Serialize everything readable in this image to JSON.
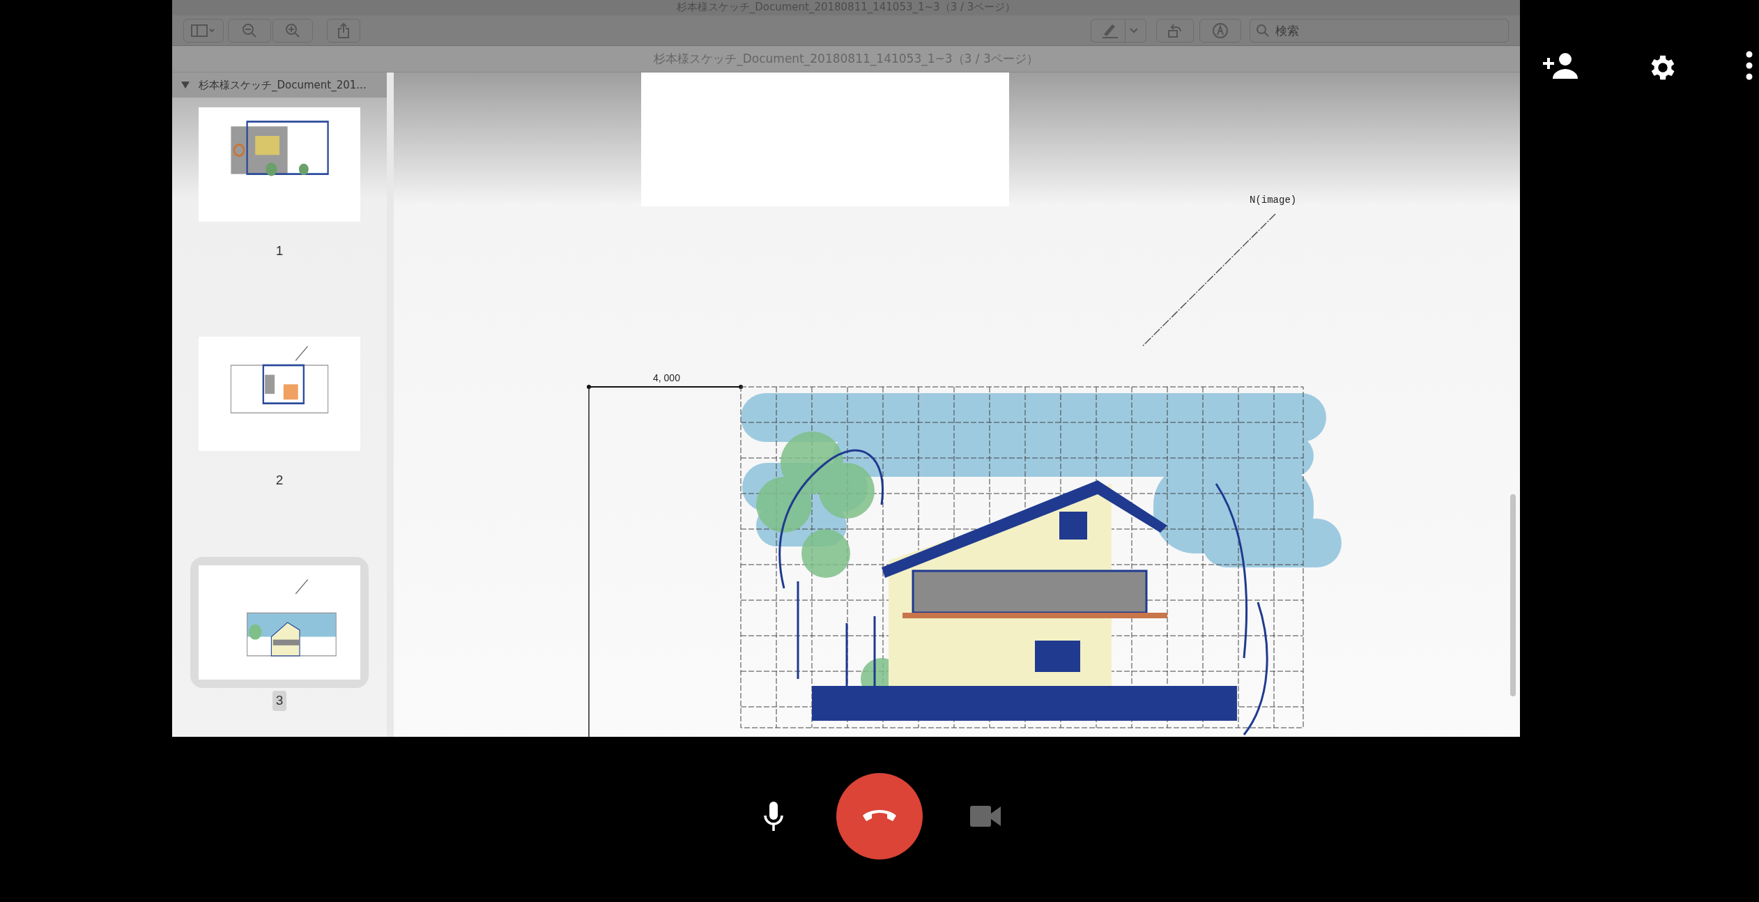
{
  "window": {
    "title": "杉本様スケッチ_Document_20180811_141053_1~3（3 / 3ページ）"
  },
  "toolbar": {
    "search": {
      "placeholder": "検索"
    }
  },
  "path_bar": {
    "text": "杉本様スケッチ_Document_20180811_141053_1~3（3 / 3ページ）"
  },
  "sidebar": {
    "document": "杉本様スケッチ_Document_201...",
    "expanded": true,
    "pages": [
      {
        "label": "1",
        "selected": false
      },
      {
        "label": "2",
        "selected": false
      },
      {
        "label": "3",
        "selected": true
      }
    ]
  },
  "page": {
    "dimension_label": "4, 000",
    "north_label": "N(image)"
  }
}
